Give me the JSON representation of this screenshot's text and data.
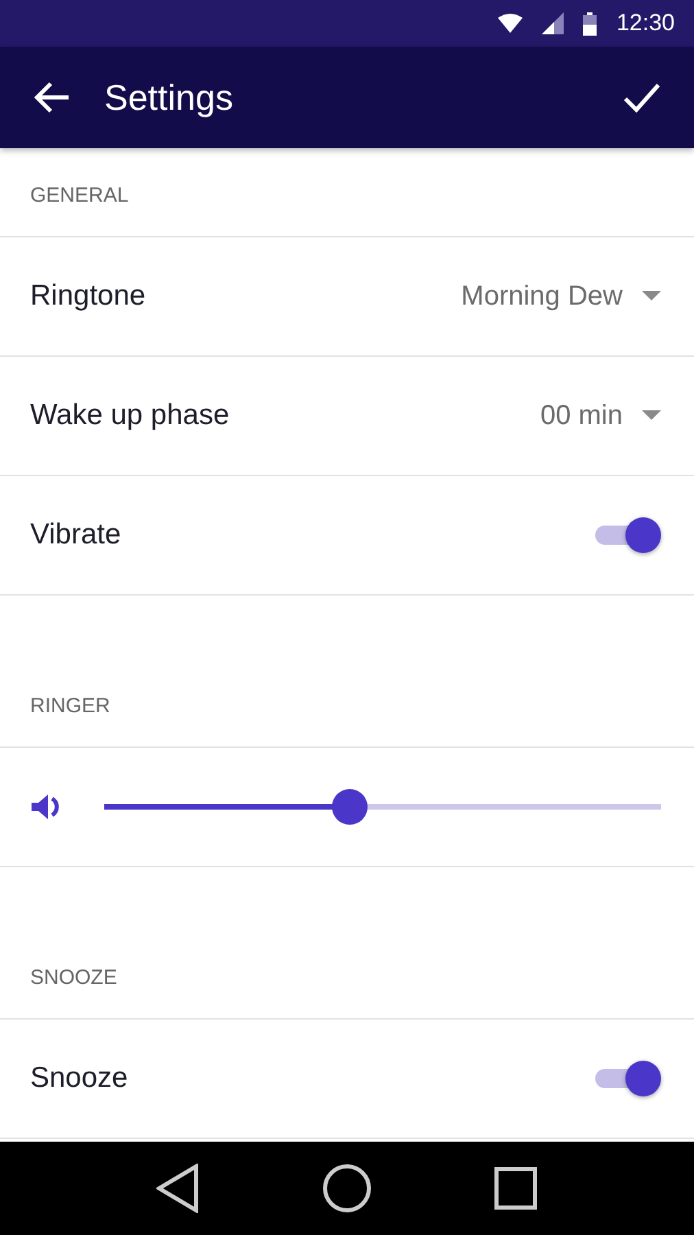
{
  "status_bar": {
    "time": "12:30"
  },
  "app_bar": {
    "title": "Settings"
  },
  "sections": [
    {
      "header": "GENERAL",
      "items": [
        {
          "kind": "dropdown",
          "label": "Ringtone",
          "value": "Morning Dew"
        },
        {
          "kind": "dropdown",
          "label": "Wake up phase",
          "value": "00 min"
        },
        {
          "kind": "toggle",
          "label": "Vibrate",
          "on": true
        }
      ]
    },
    {
      "header": "RINGER",
      "items": [
        {
          "kind": "slider",
          "level": 0.44
        }
      ]
    },
    {
      "header": "SNOOZE",
      "items": [
        {
          "kind": "toggle",
          "label": "Snooze",
          "on": true
        }
      ]
    }
  ]
}
